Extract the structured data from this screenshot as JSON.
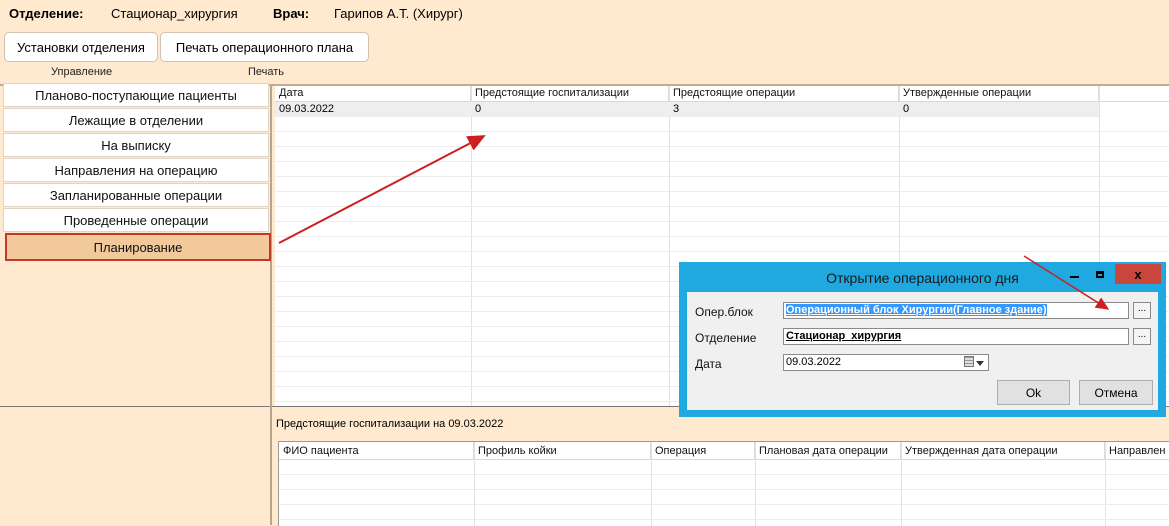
{
  "header": {
    "dept_label": "Отделение:",
    "dept_value": "Стационар_хирургия",
    "doctor_label": "Врач:",
    "doctor_value": "Гарипов А.Т. (Хирург)"
  },
  "toolbar": {
    "settings_label": "Установки отделения",
    "print_plan_label": "Печать операционного плана",
    "group_manage": "Управление",
    "group_print": "Печать"
  },
  "nav": {
    "items": [
      {
        "label": "Планово-поступающие пациенты"
      },
      {
        "label": "Лежащие в отделении"
      },
      {
        "label": "На выписку"
      },
      {
        "label": "Направления на операцию"
      },
      {
        "label": "Запланированные операции"
      },
      {
        "label": "Проведенные операции"
      },
      {
        "label": "Планирование"
      }
    ],
    "active_index": 6
  },
  "top_grid": {
    "columns": [
      "Дата",
      "Предстоящие госпитализации",
      "Предстоящие операции",
      "Утвержденные операции"
    ],
    "rows": [
      [
        "09.03.2022",
        "0",
        "3",
        "0"
      ]
    ]
  },
  "bottom_section": {
    "label": "Предстоящие госпитализации на 09.03.2022",
    "columns": [
      "ФИО пациента",
      "Профиль койки",
      "Операция",
      "Плановая дата операции",
      "Утвержденная дата операции",
      "Направлен"
    ]
  },
  "dialog": {
    "title": "Открытие операционного дня",
    "minimize": "—",
    "maximize": "☐",
    "close": "x",
    "op_block_label": "Опер.блок",
    "op_block_value": "Операционный блок Хирургии(Главное здание)",
    "dept_label": "Отделение",
    "dept_value": "Стационар_хирургия",
    "date_label": "Дата",
    "date_value": "09.03.2022",
    "ellipsis": "...",
    "ok_label": "Ok",
    "cancel_label": "Отмена"
  },
  "colors": {
    "background": "#ffe9cf",
    "active_nav": "#f1c99b",
    "highlight_border": "#c0392b",
    "dialog_frame": "#1fa9e0",
    "close_button": "#c9463d",
    "arrow": "#cc1f1f"
  }
}
